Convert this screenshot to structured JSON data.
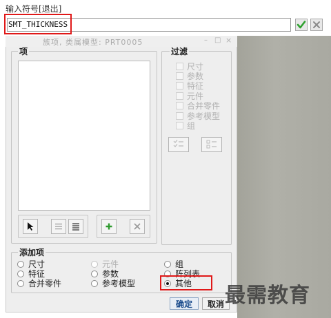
{
  "prompt": {
    "label": "输入符号[退出]"
  },
  "input": {
    "value": "SMT_THICKNESS"
  },
  "icons": {
    "accept": "checkmark-icon",
    "reject": "x-icon"
  },
  "dialog": {
    "title": "族项,   类属模型:  PRT0005",
    "window_controls": {
      "minimize": "–",
      "maximize": "□",
      "close": "×"
    },
    "items_group": {
      "legend": "项",
      "items": []
    },
    "filter_group": {
      "legend": "过滤",
      "options": [
        {
          "label": "尺寸",
          "checked": false,
          "enabled": false
        },
        {
          "label": "参数",
          "checked": false,
          "enabled": false
        },
        {
          "label": "特征",
          "checked": false,
          "enabled": false
        },
        {
          "label": "元件",
          "checked": false,
          "enabled": false
        },
        {
          "label": "合并零件",
          "checked": false,
          "enabled": false
        },
        {
          "label": "参考模型",
          "checked": false,
          "enabled": false
        },
        {
          "label": "组",
          "checked": false,
          "enabled": false
        }
      ]
    },
    "add_group": {
      "legend": "添加项",
      "options": [
        {
          "label": "尺寸",
          "enabled": true,
          "selected": false
        },
        {
          "label": "特征",
          "enabled": true,
          "selected": false
        },
        {
          "label": "合并零件",
          "enabled": true,
          "selected": false
        },
        {
          "label": "元件",
          "enabled": false,
          "selected": false
        },
        {
          "label": "参数",
          "enabled": true,
          "selected": false
        },
        {
          "label": "参考模型",
          "enabled": true,
          "selected": false
        },
        {
          "label": "组",
          "enabled": true,
          "selected": false
        },
        {
          "label": "阵列表",
          "enabled": true,
          "selected": false
        },
        {
          "label": "其他",
          "enabled": true,
          "selected": true
        }
      ]
    },
    "buttons": {
      "confirm": "确定",
      "cancel": "取消"
    }
  },
  "watermark": "最需教育",
  "colors": {
    "highlight": "#e01818",
    "accept_green": "#2fa12f",
    "dialog_bg": "#eeeeee"
  }
}
